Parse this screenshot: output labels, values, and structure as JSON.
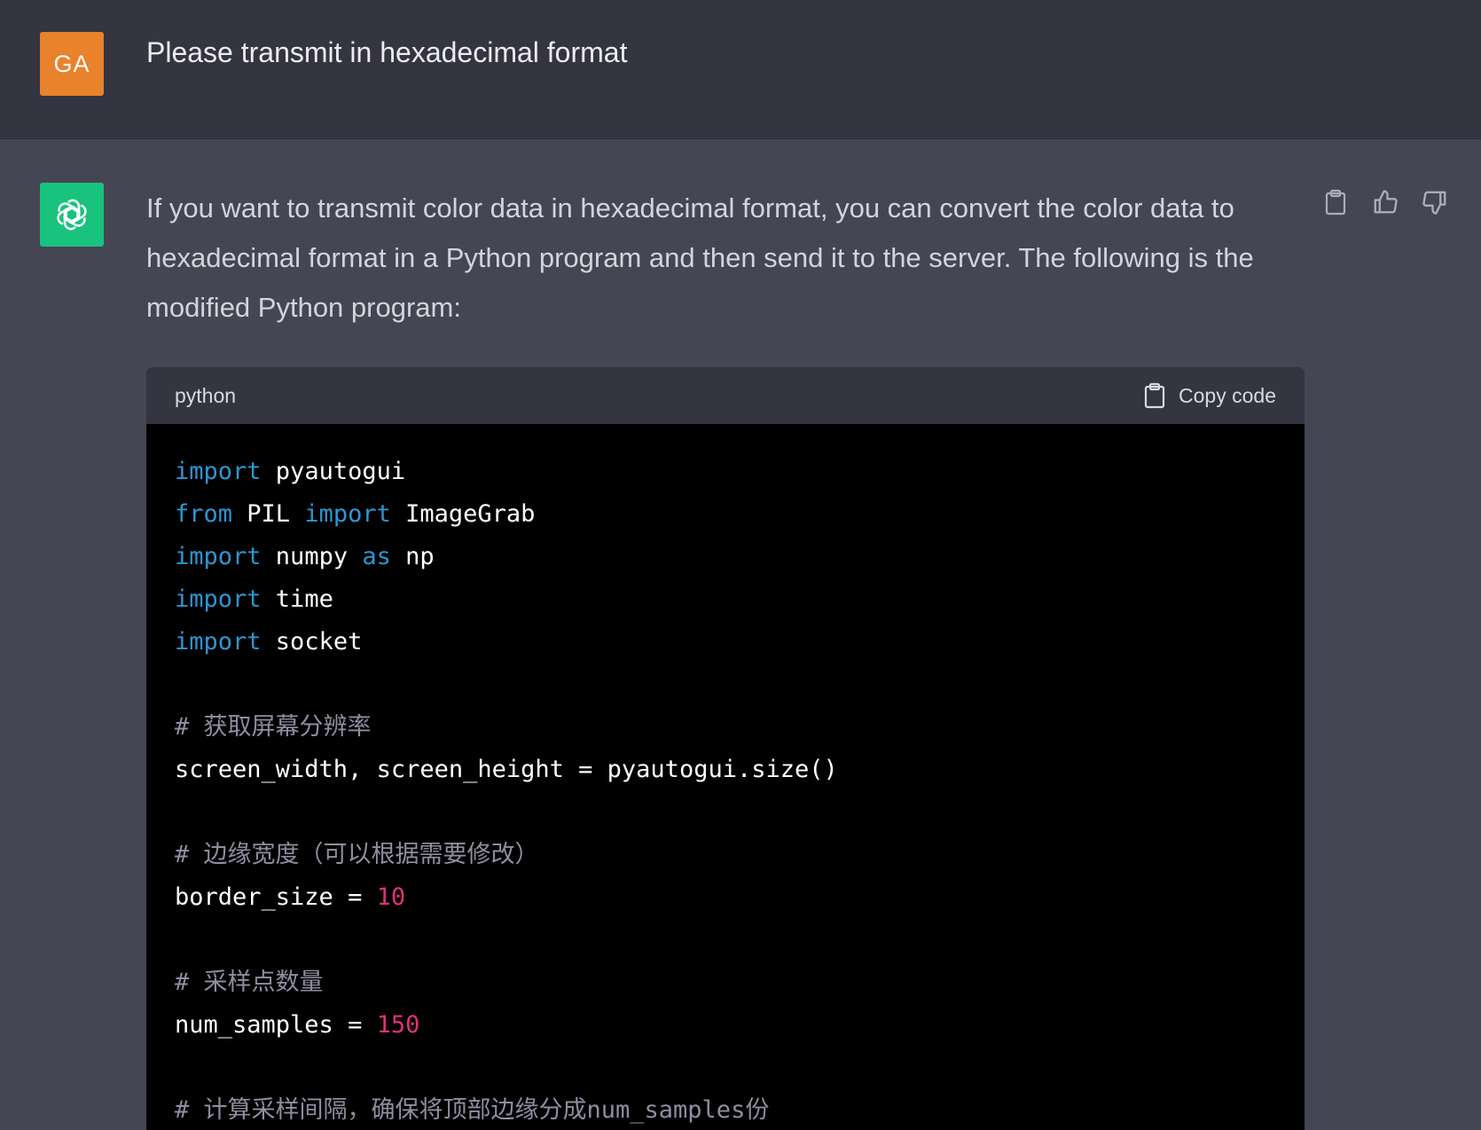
{
  "user": {
    "avatar_text": "GA",
    "message": "Please transmit in hexadecimal format"
  },
  "assistant": {
    "message": "If you want to transmit color data in hexadecimal format, you can convert the color data to hexadecimal format in a Python program and then send it to the server. The following is the modified Python program:",
    "avatar_icon": "openai-logo-icon",
    "actions": {
      "copy_icon": "clipboard-icon",
      "like_icon": "thumbs-up-icon",
      "dislike_icon": "thumbs-down-icon"
    }
  },
  "code_block": {
    "language": "python",
    "copy_label": "Copy code",
    "lines": [
      [
        {
          "t": "import",
          "c": "kw"
        },
        {
          "t": " pyautogui",
          "c": ""
        }
      ],
      [
        {
          "t": "from",
          "c": "kw"
        },
        {
          "t": " PIL ",
          "c": ""
        },
        {
          "t": "import",
          "c": "kw"
        },
        {
          "t": " ImageGrab",
          "c": ""
        }
      ],
      [
        {
          "t": "import",
          "c": "kw"
        },
        {
          "t": " numpy ",
          "c": ""
        },
        {
          "t": "as",
          "c": "kw"
        },
        {
          "t": " np",
          "c": ""
        }
      ],
      [
        {
          "t": "import",
          "c": "kw"
        },
        {
          "t": " time",
          "c": ""
        }
      ],
      [
        {
          "t": "import",
          "c": "kw"
        },
        {
          "t": " socket",
          "c": ""
        }
      ],
      [],
      [
        {
          "t": "# 获取屏幕分辨率",
          "c": "cm"
        }
      ],
      [
        {
          "t": "screen_width, screen_height = pyautogui.size()",
          "c": ""
        }
      ],
      [],
      [
        {
          "t": "# 边缘宽度（可以根据需要修改）",
          "c": "cm"
        }
      ],
      [
        {
          "t": "border_size = ",
          "c": ""
        },
        {
          "t": "10",
          "c": "num"
        }
      ],
      [],
      [
        {
          "t": "# 采样点数量",
          "c": "cm"
        }
      ],
      [
        {
          "t": "num_samples = ",
          "c": ""
        },
        {
          "t": "150",
          "c": "num"
        }
      ],
      [],
      [
        {
          "t": "# 计算采样间隔，确保将顶部边缘分成num_samples份",
          "c": "cm"
        }
      ]
    ]
  },
  "colors": {
    "user_bg": "#343541",
    "assistant_bg": "#444654",
    "user_avatar": "#e8822b",
    "bot_avatar": "#19c37d",
    "keyword": "#2e95d3",
    "number": "#df3079",
    "comment": "#8e8ea0"
  }
}
